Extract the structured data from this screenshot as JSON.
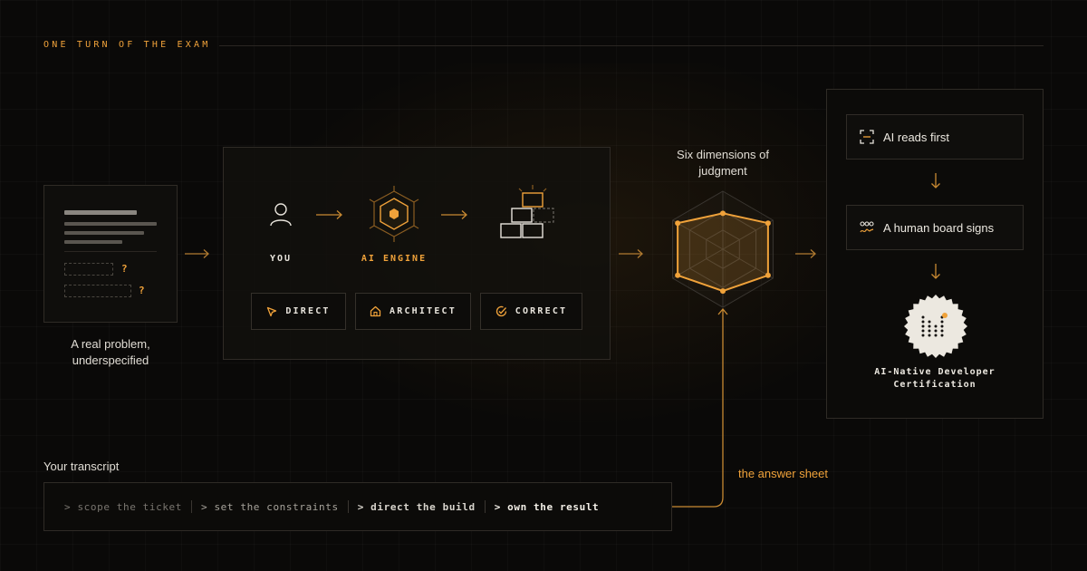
{
  "eyebrow": "ONE TURN OF THE EXAM",
  "problem": {
    "marks": [
      "?",
      "?"
    ],
    "caption_line1": "A real problem,",
    "caption_line2": "underspecified"
  },
  "engine": {
    "nodes": [
      {
        "label": "YOU",
        "icon": "user-icon"
      },
      {
        "label": "AI ENGINE",
        "icon": "hexagon-engine-icon"
      },
      {
        "label": "",
        "icon": "bricks-icon"
      }
    ],
    "actions": [
      {
        "label": "DIRECT",
        "icon": "cursor-icon"
      },
      {
        "label": "ARCHITECT",
        "icon": "house-icon"
      },
      {
        "label": "CORRECT",
        "icon": "check-circle-icon"
      }
    ]
  },
  "radar": {
    "title_line1": "Six dimensions of",
    "title_line2": "judgment",
    "values": [
      0.62,
      0.9,
      0.9,
      0.72,
      0.9,
      0.9
    ]
  },
  "certification": {
    "steps": [
      {
        "label": "AI reads first",
        "icon": "scan-icon"
      },
      {
        "label": "A human board signs",
        "icon": "signature-icon"
      }
    ],
    "badge_icon": "certification-seal-icon",
    "name_line1": "AI-Native Developer",
    "name_line2": "Certification"
  },
  "transcript": {
    "label": "Your transcript",
    "steps": [
      {
        "text": "> scope the ticket"
      },
      {
        "text": "> set the constraints"
      },
      {
        "text": "> direct the build"
      },
      {
        "text": "> own the result"
      }
    ]
  },
  "answer_sheet_label": "the answer sheet",
  "colors": {
    "accent": "#f0a23a",
    "background": "#0a0908",
    "panel_border": "#2f2b26",
    "text": "#e8e4dc"
  }
}
